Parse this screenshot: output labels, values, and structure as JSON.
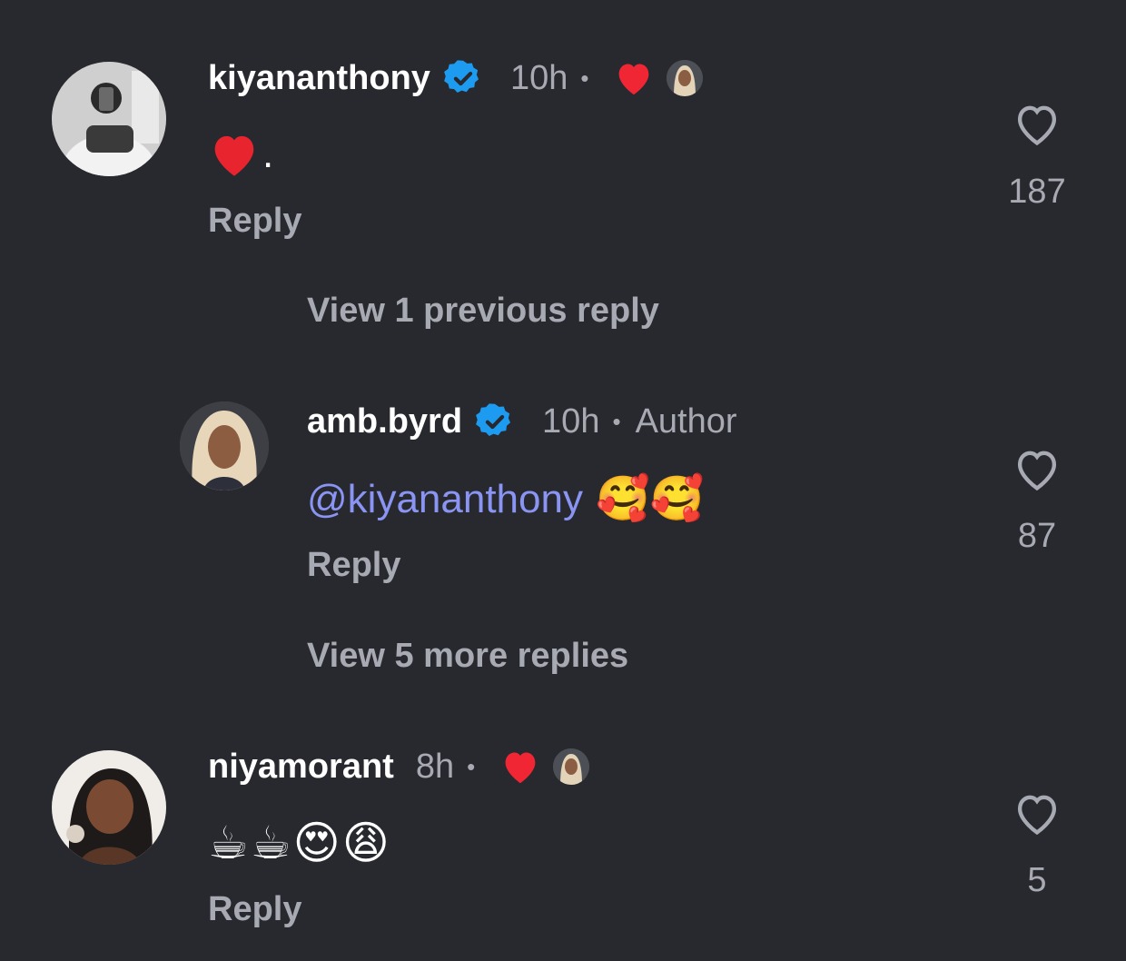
{
  "comments": [
    {
      "username": "kiyananthony",
      "verified": true,
      "time": "10h",
      "dot": "•",
      "text_suffix": ".",
      "reply_label": "Reply",
      "like_count": "187",
      "liked_by_author": true,
      "view_replies_label": "View 1 previous reply"
    },
    {
      "username": "amb.byrd",
      "verified": true,
      "time": "10h",
      "dot": "•",
      "author_badge": "Author",
      "mention": "@kiyananthony",
      "emojis": "🥰🥰",
      "reply_label": "Reply",
      "like_count": "87",
      "view_replies_label": "View 5 more replies"
    },
    {
      "username": "niyamorant",
      "verified": false,
      "time": "8h",
      "dot": "•",
      "emojis": [
        "☕",
        "☕",
        "😍",
        "😩"
      ],
      "reply_label": "Reply",
      "like_count": "5",
      "liked_by_author": true
    }
  ],
  "colors": {
    "background": "#27292e",
    "secondary_text": "#a7aab2",
    "mention": "#8a94f2",
    "verified": "#1d9bf0",
    "heart": "#f02634"
  }
}
